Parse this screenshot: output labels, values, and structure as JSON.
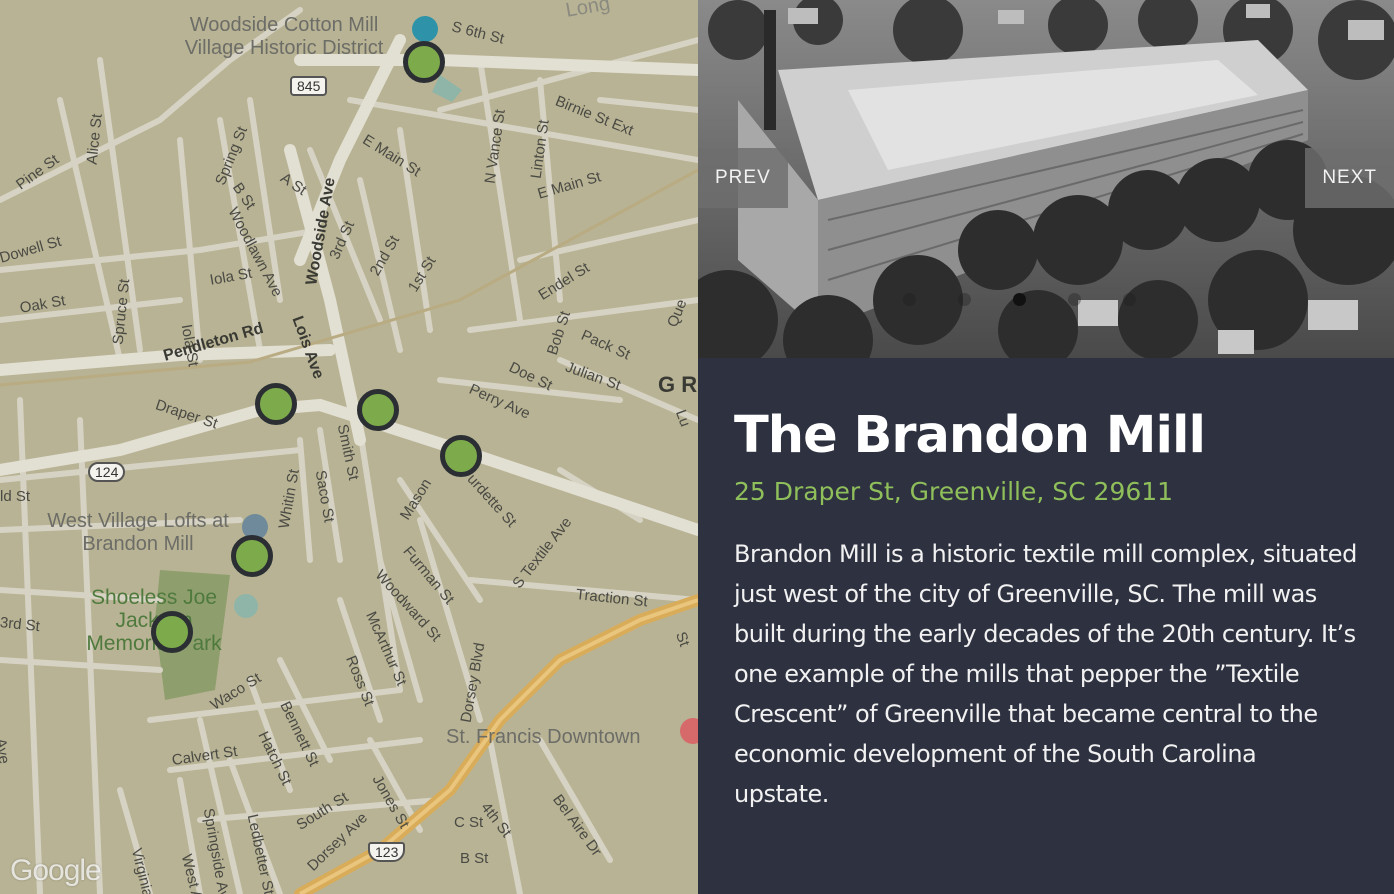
{
  "map": {
    "labels": {
      "woodside": "Woodside Cotton Mill Village Historic District",
      "west_village": "West Village Lofts at Brandon Mill",
      "shoeless": "Shoeless Joe Jackson Memorial Park",
      "st_francis": "St. Francis Downtown",
      "gr": "G R",
      "long": "Long",
      "s6th": "S 6th St",
      "birnie": "Birnie St Ext",
      "emain1": "E Main St",
      "emain2": "E Main St",
      "nvance": "N Vance St",
      "linton": "Linton St",
      "pine": "Pine St",
      "alice": "Alice St",
      "spring": "Spring St",
      "ast": "A St",
      "bst": "B St",
      "woodlawn": "Woodlawn Ave",
      "woodside_ave": "Woodside Ave",
      "third": "3rd St",
      "second": "2nd St",
      "first": "1st St",
      "dowell": "Dowell St",
      "oak": "Oak St",
      "spruce": "Spruce St",
      "iola1": "Iola St",
      "iola2": "Iola St",
      "pendleton": "Pendleton Rd",
      "lois": "Lois Ave",
      "endel": "Endel St",
      "bob": "Bob St",
      "pack": "Pack St",
      "julian": "Julian St",
      "doe": "Doe St",
      "perry": "Perry Ave",
      "draper": "Draper St",
      "smith": "Smith St",
      "mason": "Mason",
      "burdette": "urdette St",
      "whitin": "Whitin St",
      "saco": "Saco St",
      "stextile": "S Textile Ave",
      "furman": "Furman St",
      "traction": "Traction St",
      "woodward": "Woodward St",
      "mcarthur": "McArthur St",
      "ross": "Ross St",
      "dorsey_blvd": "Dorsey Blvd",
      "waco": "Waco St",
      "bennett": "Bennett St",
      "hatch": "Hatch St",
      "calvert": "Calvert St",
      "springside": "Springside Ave",
      "ledbetter": "Ledbetter St",
      "south": "South St",
      "dorsey_ave": "Dorsey Ave",
      "jones": "Jones St",
      "fourth": "4th St",
      "belaire": "Bel Aire Dr",
      "cst": "C St",
      "bst2": "B St",
      "virginia": "Virginia",
      "westa": "West A",
      "ld": "ld St",
      "third_left": "3rd St",
      "que": "Que",
      "lu": "Lu",
      "st_right": "St",
      "ave_left": "Ave"
    },
    "shields": {
      "r845": "845",
      "r124": "124",
      "us123": "123"
    },
    "attribution": "Google",
    "marker_color": "#7daa4b"
  },
  "photo": {
    "prev_label": "PREV",
    "next_label": "NEXT",
    "slide_count": 5,
    "active_slide": 3
  },
  "place": {
    "title": "The Brandon Mill",
    "address": "25 Draper St, Greenville, SC 29611",
    "description": "Brandon Mill is a historic textile mill complex, situated just west of the city of Greenville, SC. The mill was built during the early decades of the 20th century. It’s one example of the mills that pepper the ”Textile Crescent” of Greenville that became central to the economic development of the South Carolina upstate."
  },
  "colors": {
    "panel_bg": "#2e3140",
    "address_green": "#8fbf5a",
    "map_bg": "#b8b394",
    "highway": "#d9ac5a"
  }
}
